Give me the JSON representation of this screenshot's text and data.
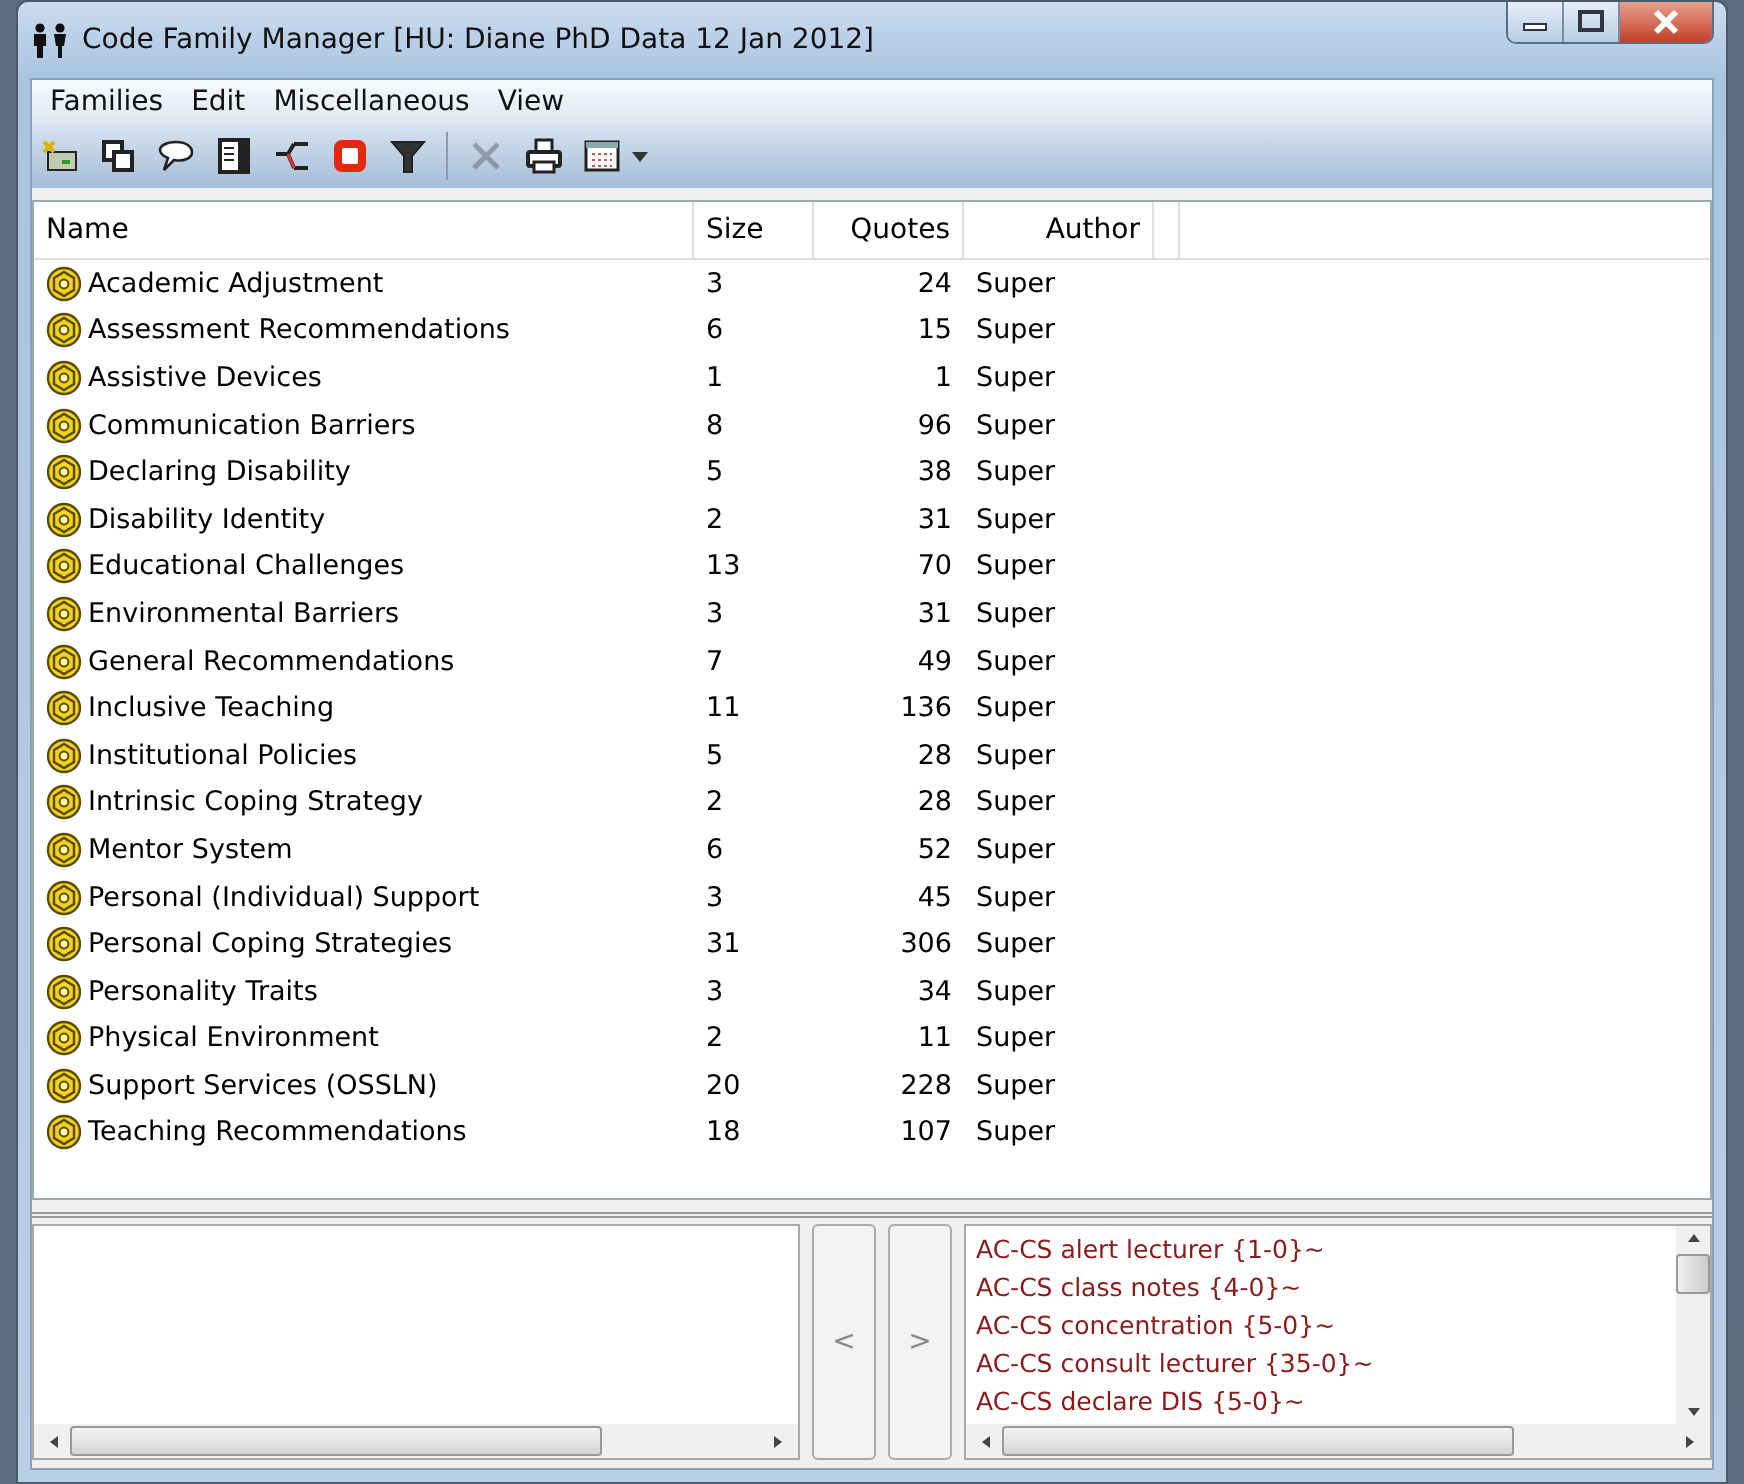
{
  "window": {
    "title": "Code Family Manager [HU: Diane PhD Data 12 Jan 2012]"
  },
  "menu": [
    "Families",
    "Edit",
    "Miscellaneous",
    "View"
  ],
  "toolbar": [
    {
      "kind": "new",
      "disabled": false
    },
    {
      "kind": "copy",
      "disabled": false
    },
    {
      "kind": "comment",
      "disabled": false
    },
    {
      "kind": "document",
      "disabled": false
    },
    {
      "kind": "network",
      "disabled": false
    },
    {
      "kind": "stop",
      "disabled": false
    },
    {
      "kind": "filter",
      "disabled": false
    },
    {
      "kind": "separator"
    },
    {
      "kind": "delete",
      "disabled": true
    },
    {
      "kind": "print",
      "disabled": false
    },
    {
      "kind": "grid",
      "disabled": false
    }
  ],
  "table": {
    "columns": [
      "Name",
      "Size",
      "Quotes",
      "Author"
    ],
    "rows": [
      {
        "name": "Academic Adjustment",
        "size": "3",
        "quotes": "24",
        "author": "Super"
      },
      {
        "name": "Assessment Recommendations",
        "size": "6",
        "quotes": "15",
        "author": "Super"
      },
      {
        "name": "Assistive Devices",
        "size": "1",
        "quotes": "1",
        "author": "Super"
      },
      {
        "name": "Communication Barriers",
        "size": "8",
        "quotes": "96",
        "author": "Super"
      },
      {
        "name": "Declaring Disability",
        "size": "5",
        "quotes": "38",
        "author": "Super"
      },
      {
        "name": "Disability Identity",
        "size": "2",
        "quotes": "31",
        "author": "Super"
      },
      {
        "name": "Educational Challenges",
        "size": "13",
        "quotes": "70",
        "author": "Super"
      },
      {
        "name": "Environmental Barriers",
        "size": "3",
        "quotes": "31",
        "author": "Super"
      },
      {
        "name": "General Recommendations",
        "size": "7",
        "quotes": "49",
        "author": "Super"
      },
      {
        "name": "Inclusive Teaching",
        "size": "11",
        "quotes": "136",
        "author": "Super"
      },
      {
        "name": "Institutional Policies",
        "size": "5",
        "quotes": "28",
        "author": "Super"
      },
      {
        "name": "Intrinsic Coping Strategy",
        "size": "2",
        "quotes": "28",
        "author": "Super"
      },
      {
        "name": "Mentor System",
        "size": "6",
        "quotes": "52",
        "author": "Super"
      },
      {
        "name": "Personal (Individual) Support",
        "size": "3",
        "quotes": "45",
        "author": "Super"
      },
      {
        "name": "Personal Coping Strategies",
        "size": "31",
        "quotes": "306",
        "author": "Super"
      },
      {
        "name": "Personality Traits",
        "size": "3",
        "quotes": "34",
        "author": "Super"
      },
      {
        "name": "Physical Environment",
        "size": "2",
        "quotes": "11",
        "author": "Super"
      },
      {
        "name": "Support Services (OSSLN)",
        "size": "20",
        "quotes": "228",
        "author": "Super"
      },
      {
        "name": "Teaching Recommendations",
        "size": "18",
        "quotes": "107",
        "author": "Super"
      }
    ]
  },
  "transfer_buttons": [
    "<",
    ">"
  ],
  "codes": [
    "AC-CS alert lecturer {1-0}~",
    "AC-CS class notes {4-0}~",
    "AC-CS concentration {5-0}~",
    "AC-CS consult lecturer {35-0}~",
    "AC-CS declare DIS {5-0}~"
  ]
}
